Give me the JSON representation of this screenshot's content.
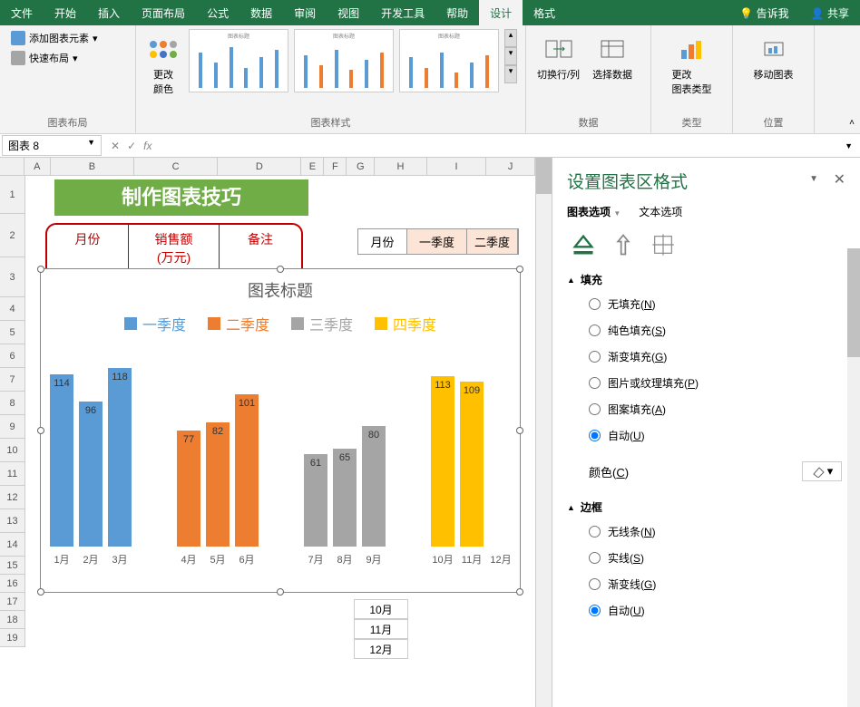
{
  "menus": [
    "文件",
    "开始",
    "插入",
    "页面布局",
    "公式",
    "数据",
    "审阅",
    "视图",
    "开发工具",
    "帮助",
    "设计",
    "格式"
  ],
  "active_menu": "设计",
  "tell_me": "告诉我",
  "share": "共享",
  "ribbon": {
    "layout_group": "图表布局",
    "add_element": "添加图表元素",
    "quick_layout": "快速布局",
    "change_colors": "更改\n颜色",
    "styles_group": "图表样式",
    "data_group": "数据",
    "switch_rowcol": "切换行/列",
    "select_data": "选择数据",
    "type_group": "类型",
    "change_type": "更改\n图表类型",
    "location_group": "位置",
    "move_chart": "移动图表"
  },
  "namebox": "图表 8",
  "banner": "制作图表技巧",
  "red_headers": [
    "月份",
    "销售额\n(万元)",
    "备注"
  ],
  "q_headers": [
    "月份",
    "一季度",
    "二季度"
  ],
  "month_tail": [
    "10月",
    "11月",
    "12月"
  ],
  "chart": {
    "title": "图表标题",
    "legend": [
      "一季度",
      "二季度",
      "三季度",
      "四季度"
    ],
    "colors": [
      "#5b9bd5",
      "#ed7d31",
      "#a5a5a5",
      "#ffc000"
    ]
  },
  "col_letters": [
    "A",
    "B",
    "C",
    "D",
    "E",
    "F",
    "G",
    "H",
    "I",
    "J"
  ],
  "row_nums": [
    1,
    2,
    3,
    4,
    5,
    6,
    7,
    8,
    9,
    10,
    11,
    12,
    13,
    14,
    15,
    16,
    17,
    18,
    19
  ],
  "format_pane": {
    "title": "设置图表区格式",
    "tab_chart_options": "图表选项",
    "tab_text_options": "文本选项",
    "fill_section": "填充",
    "border_section": "边框",
    "fill_options": {
      "no_fill": "无填充(N)",
      "solid": "纯色填充(S)",
      "gradient": "渐变填充(G)",
      "picture": "图片或纹理填充(P)",
      "pattern": "图案填充(A)",
      "auto": "自动(U)"
    },
    "border_options": {
      "no_line": "无线条(N)",
      "solid_line": "实线(S)",
      "gradient_line": "渐变线(G)",
      "auto_line": "自动(U)"
    },
    "color_label": "颜色(C)"
  },
  "chart_data": {
    "type": "bar",
    "title": "图表标题",
    "categories": [
      "1月",
      "2月",
      "3月",
      "4月",
      "5月",
      "6月",
      "7月",
      "8月",
      "9月",
      "10月",
      "11月",
      "12月"
    ],
    "series": [
      {
        "name": "一季度",
        "color": "#5b9bd5",
        "values": [
          114,
          96,
          118,
          null,
          null,
          null,
          null,
          null,
          null,
          null,
          null,
          null
        ]
      },
      {
        "name": "二季度",
        "color": "#ed7d31",
        "values": [
          null,
          null,
          null,
          77,
          82,
          101,
          null,
          null,
          null,
          null,
          null,
          null
        ]
      },
      {
        "name": "三季度",
        "color": "#a5a5a5",
        "values": [
          null,
          null,
          null,
          null,
          null,
          null,
          61,
          65,
          80,
          null,
          null,
          null
        ]
      },
      {
        "name": "四季度",
        "color": "#ffc000",
        "values": [
          null,
          null,
          null,
          null,
          null,
          null,
          null,
          null,
          null,
          113,
          109,
          null
        ]
      }
    ],
    "ylim": [
      0,
      120
    ]
  }
}
